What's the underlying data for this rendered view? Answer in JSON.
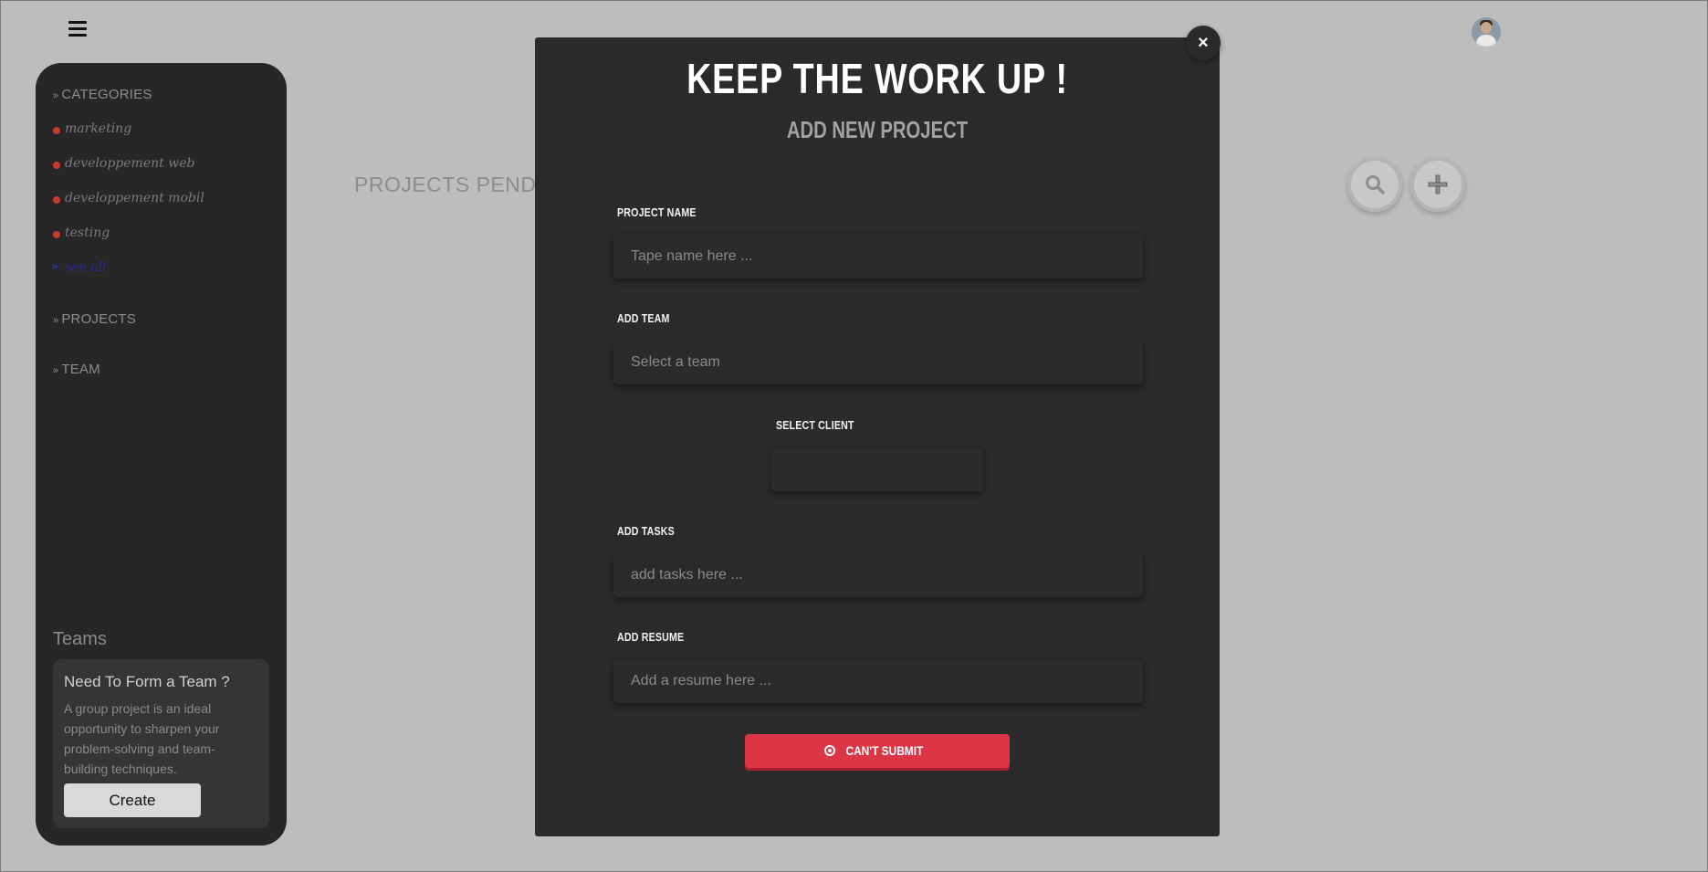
{
  "sidebar": {
    "categories_heading": "CATEGORIES",
    "categories": [
      {
        "label": "marketing"
      },
      {
        "label": "developpement web"
      },
      {
        "label": "developpement mobil"
      },
      {
        "label": "testing"
      }
    ],
    "see_all": "see all",
    "projects_heading": "PROJECTS",
    "team_heading": "TEAM",
    "teams_title": "Teams",
    "teams_card": {
      "heading": "Need To Form a Team ?",
      "body": "A group project is an ideal opportunity to sharpen your problem-solving and team-building techniques.",
      "button": "Create"
    }
  },
  "main": {
    "pending_title": "PROJECTS PENDING"
  },
  "modal": {
    "close": "×",
    "title": "KEEP THE WORK UP !",
    "subtitle": "ADD NEW PROJECT",
    "fields": {
      "project_name": {
        "label": "PROJECT NAME",
        "placeholder": "Tape name here  ..."
      },
      "team": {
        "label": "ADD TEAM",
        "placeholder": "Select a team"
      },
      "client": {
        "label": "SELECT CLIENT",
        "placeholder": ""
      },
      "tasks": {
        "label": "ADD TASKS",
        "placeholder": "add tasks here  ..."
      },
      "resume": {
        "label": "ADD RESUME",
        "placeholder": "Add a resume here ..."
      }
    },
    "submit": "CAN'T SUBMIT"
  },
  "colors": {
    "backdrop": "#bdbdbd",
    "sidebar": "#272727",
    "modal": "#2b2b2b",
    "submit": "#dc3545",
    "category_dot": "#c53a2a",
    "see_all_arrow": "#2d3cc8"
  }
}
